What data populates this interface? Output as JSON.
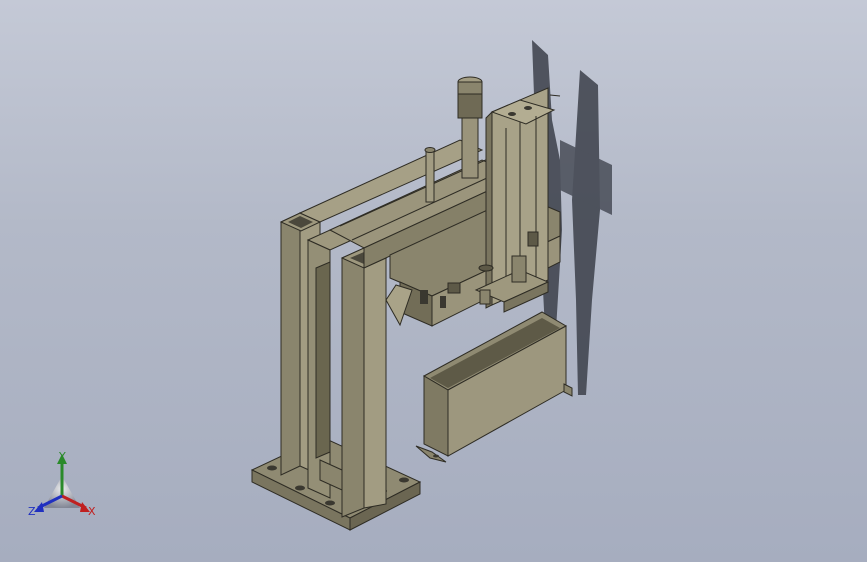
{
  "viewport": {
    "background_top": "#c4c9d6",
    "background_bottom": "#a6adbf",
    "model_color": "#8f8a72",
    "shadow_color": "#3c404a"
  },
  "triad": {
    "x_label": "X",
    "y_label": "Y",
    "z_label": "Z",
    "x_color": "#c02020",
    "y_color": "#2a8a2a",
    "z_color": "#2030c0"
  }
}
